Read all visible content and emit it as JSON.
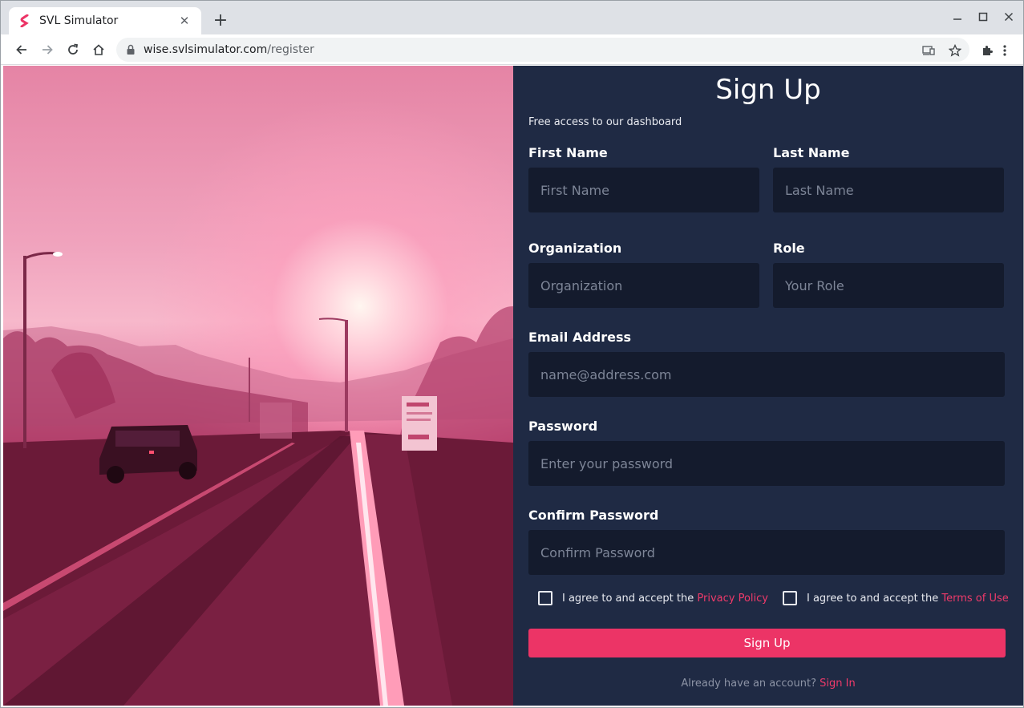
{
  "browser": {
    "tab_title": "SVL Simulator",
    "url_host": "wise.svlsimulator.com",
    "url_path": "/register",
    "accent_color": "#ec3466"
  },
  "form": {
    "title": "Sign Up",
    "subtitle": "Free access to our dashboard",
    "first_name": {
      "label": "First Name",
      "placeholder": "First Name"
    },
    "last_name": {
      "label": "Last Name",
      "placeholder": "Last Name"
    },
    "organization": {
      "label": "Organization",
      "placeholder": "Organization"
    },
    "role": {
      "label": "Role",
      "placeholder": "Your Role"
    },
    "email": {
      "label": "Email Address",
      "placeholder": "name@address.com"
    },
    "password": {
      "label": "Password",
      "placeholder": "Enter your password"
    },
    "confirm_password": {
      "label": "Confirm Password",
      "placeholder": "Confirm Password"
    },
    "privacy": {
      "text": "I agree to and accept the",
      "link": "Privacy Policy"
    },
    "terms": {
      "text": "I agree to and accept the",
      "link": "Terms of Use"
    },
    "submit_label": "Sign Up",
    "signin_text": "Already have an account?",
    "signin_link": "Sign In"
  }
}
